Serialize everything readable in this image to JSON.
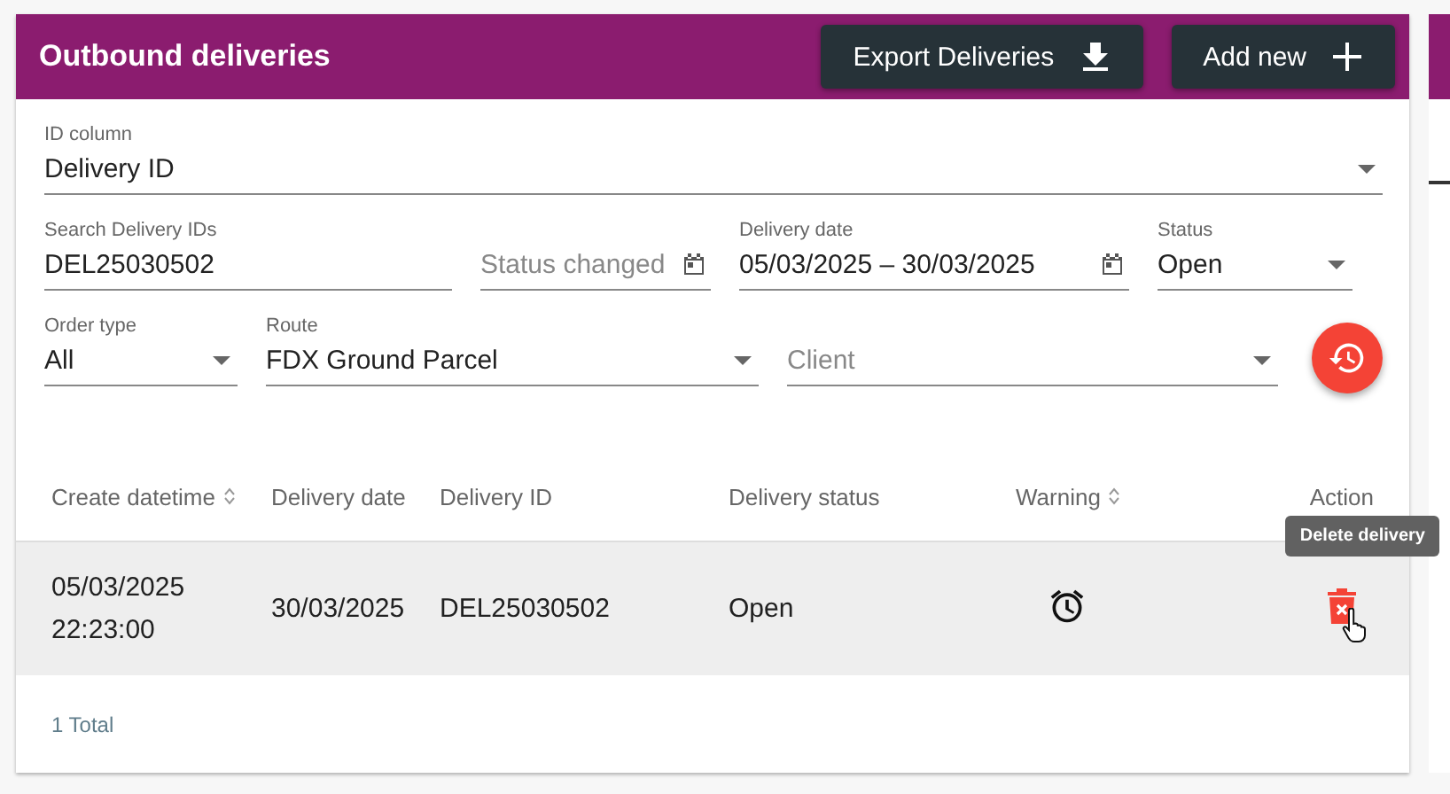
{
  "header": {
    "title": "Outbound deliveries",
    "buttons": [
      {
        "label": "Export Deliveries",
        "kind": "download"
      },
      {
        "label": "Add new",
        "kind": "add"
      }
    ]
  },
  "id_column": {
    "label": "ID column",
    "value": "Delivery ID"
  },
  "filters": [
    {
      "kind": "text",
      "label": "Search Delivery IDs",
      "value": "DEL25030502"
    },
    {
      "kind": "date",
      "placeholder": "Status changed"
    },
    {
      "kind": "date",
      "label": "Delivery date",
      "value": "05/03/2025 – 30/03/2025"
    },
    {
      "kind": "select",
      "label": "Status",
      "value": "Open"
    },
    {
      "kind": "select",
      "label": "Order type",
      "value": "All"
    },
    {
      "kind": "select",
      "label": "Route",
      "value": "FDX Ground Parcel"
    },
    {
      "kind": "select",
      "placeholder": "Client"
    }
  ],
  "table": {
    "columns": [
      {
        "label": "Create datetime",
        "sortable": true
      },
      {
        "label": "Delivery date",
        "sortable": false
      },
      {
        "label": "Delivery ID",
        "sortable": false
      },
      {
        "label": "Delivery status",
        "sortable": false
      },
      {
        "label": "Warning",
        "sortable": true
      },
      {
        "label": "Action",
        "sortable": false
      }
    ],
    "rows": [
      {
        "create_datetime": [
          "05/03/2025",
          "22:23:00"
        ],
        "delivery_date": "30/03/2025",
        "delivery_id": "DEL25030502",
        "status": "Open",
        "warning": true,
        "hovered": true
      }
    ]
  },
  "tooltip": "Delete delivery",
  "total": "1 Total"
}
